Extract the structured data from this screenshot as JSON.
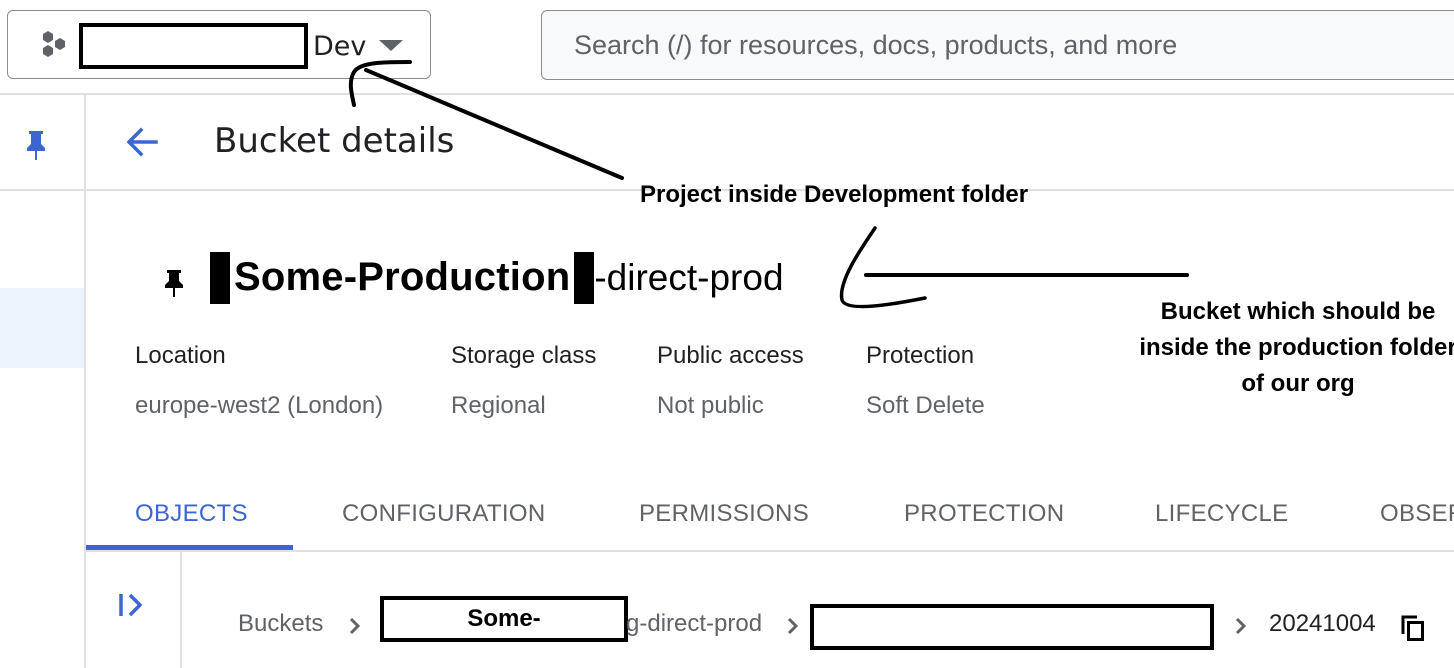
{
  "top_bar": {
    "project_picker": {
      "icon": "hexagon-cluster-icon",
      "project_name_redacted": true,
      "project_suffix": "Dev",
      "dropdown_icon": "triangle-down-icon"
    },
    "search": {
      "placeholder": "Search (/) for resources, docs, products, and more",
      "value": ""
    }
  },
  "left_rail": {
    "pin_icon": "pin-icon",
    "active_item_index": 1
  },
  "header": {
    "back_icon": "arrow-left-icon",
    "title": "Bucket details"
  },
  "bucket": {
    "pin_icon": "pin-icon",
    "name_bold_part": "Some-Production",
    "name_plain_part": "-direct-prod"
  },
  "meta": [
    {
      "label": "Location",
      "value": "europe-west2 (London)"
    },
    {
      "label": "Storage class",
      "value": "Regional"
    },
    {
      "label": "Public access",
      "value": "Not public"
    },
    {
      "label": "Protection",
      "value": "Soft Delete"
    }
  ],
  "tabs": [
    {
      "label": "OBJECTS",
      "active": true
    },
    {
      "label": "CONFIGURATION",
      "active": false
    },
    {
      "label": "PERMISSIONS",
      "active": false
    },
    {
      "label": "PROTECTION",
      "active": false
    },
    {
      "label": "LIFECYCLE",
      "active": false
    },
    {
      "label": "OBSER",
      "active": false
    }
  ],
  "objects_panel": {
    "expand_icon": "expand-panel-icon",
    "breadcrumb": {
      "root": "Buckets",
      "bucket_redacted_visible": "Some-",
      "bucket_tail": "g-direct-prod",
      "folder_redacted": true,
      "current": "20241004",
      "copy_icon": "copy-icon"
    }
  },
  "annotations": {
    "project_note": "Project inside Development folder",
    "bucket_note": "Bucket which should be inside the production folder of our org"
  },
  "colors": {
    "accent_blue": "#3b66d2",
    "rail_active_bg": "#eef4fd",
    "divider": "#e0e0e0",
    "secondary_text": "#5f6368"
  }
}
